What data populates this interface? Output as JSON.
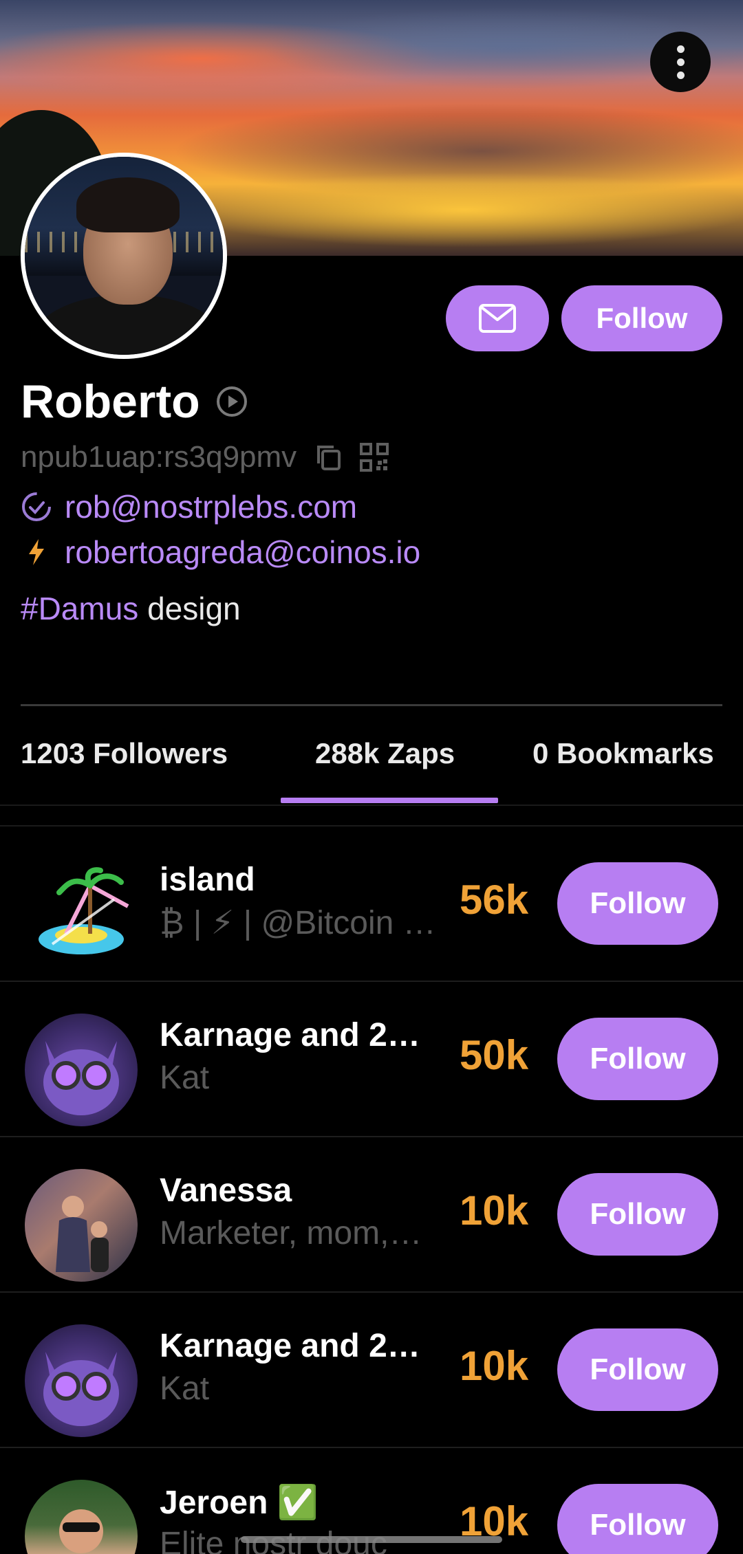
{
  "profile": {
    "name": "Roberto",
    "npub": "npub1uap:rs3q9pmv",
    "nip05": "rob@nostrplebs.com",
    "lightning": "robertoagreda@coinos.io",
    "about_tag": "#Damus",
    "about_text": " design"
  },
  "actions": {
    "follow_label": "Follow"
  },
  "tabs": [
    {
      "label": "1203  Followers"
    },
    {
      "label": "288k Zaps"
    },
    {
      "label": "0 Bookmarks"
    }
  ],
  "active_tab": "288k Zaps",
  "zappers": [
    {
      "name": "island",
      "subtitle": "₿ | ⚡ | @Bitcoin …",
      "amount": "56k",
      "follow": "Follow",
      "avatar": "island-avatar"
    },
    {
      "name": "Karnage and 2…",
      "subtitle": "Kat",
      "amount": "50k",
      "follow": "Follow",
      "avatar": "cat-avatar"
    },
    {
      "name": "Vanessa",
      "subtitle": "Marketer, mom,…",
      "amount": "10k",
      "follow": "Follow",
      "avatar": "vanessa-avatar"
    },
    {
      "name": "Karnage and 2…",
      "subtitle": "Kat",
      "amount": "10k",
      "follow": "Follow",
      "avatar": "cat-avatar"
    },
    {
      "name": "Jeroen ✅",
      "subtitle": "Elite nostr douc",
      "amount": "10k",
      "follow": "Follow",
      "avatar": "jeroen-avatar"
    }
  ],
  "colors": {
    "accent": "#b77ef2",
    "zap_amount": "#f0a237",
    "background": "#000000",
    "muted_text": "#5f5f5f"
  }
}
